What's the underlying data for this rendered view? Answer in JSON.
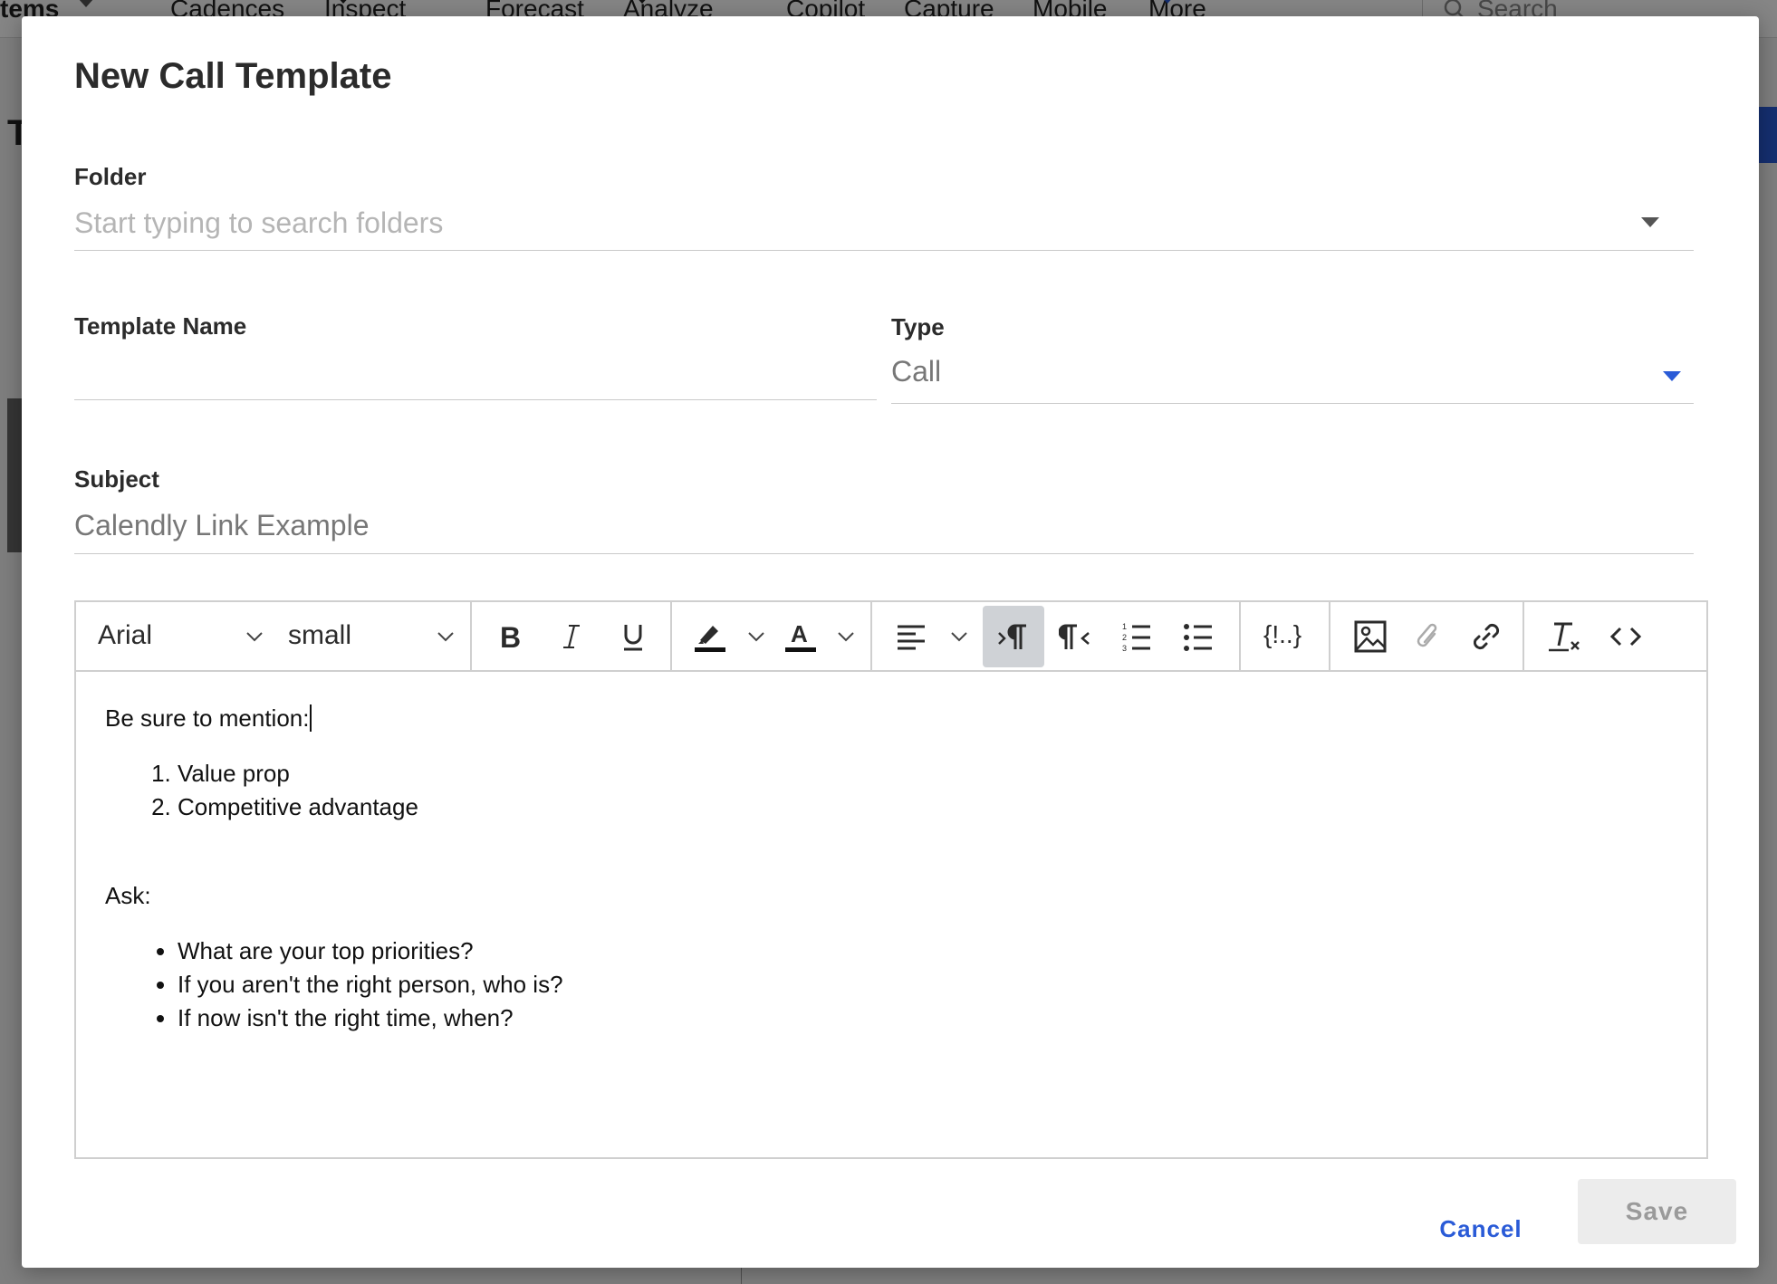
{
  "background": {
    "nav_partial": "tems",
    "nav_items": [
      "Cadences",
      "Inspect",
      "Forecast",
      "Analyze",
      "Copilot",
      "Capture",
      "Mobile"
    ],
    "nav_more": "More",
    "search_label": "Search",
    "side_letter": "T"
  },
  "modal": {
    "title": "New Call Template",
    "folder": {
      "label": "Folder",
      "placeholder": "Start typing to search folders"
    },
    "template_name": {
      "label": "Template Name",
      "value": ""
    },
    "type": {
      "label": "Type",
      "value": "Call"
    },
    "subject": {
      "label": "Subject",
      "value": "Calendly Link Example"
    },
    "editor": {
      "toolbar": {
        "font": "Arial",
        "size": "small",
        "variables_label": "{!..}",
        "icons": [
          "bold-icon",
          "italic-icon",
          "underline-icon",
          "highlight-icon",
          "font-color-icon",
          "align-left-icon",
          "ltr-icon",
          "rtl-icon",
          "numbered-list-icon",
          "bulleted-list-icon",
          "variables-icon",
          "image-icon",
          "attachment-icon",
          "link-icon",
          "clear-format-icon",
          "source-code-icon"
        ]
      },
      "content": {
        "intro": "Be sure to mention:",
        "numbered": [
          "Value prop",
          "Competitive advantage"
        ],
        "ask_label": "Ask:",
        "bullets": [
          "What are your top priorities?",
          "If you aren't the right person, who is?",
          "If now isn't the right time, when?"
        ]
      }
    },
    "footer": {
      "cancel": "Cancel",
      "save": "Save"
    }
  },
  "colors": {
    "accent": "#2a5bd7",
    "active_button": "#cfd2d6",
    "disabled_bg": "#ececec"
  }
}
